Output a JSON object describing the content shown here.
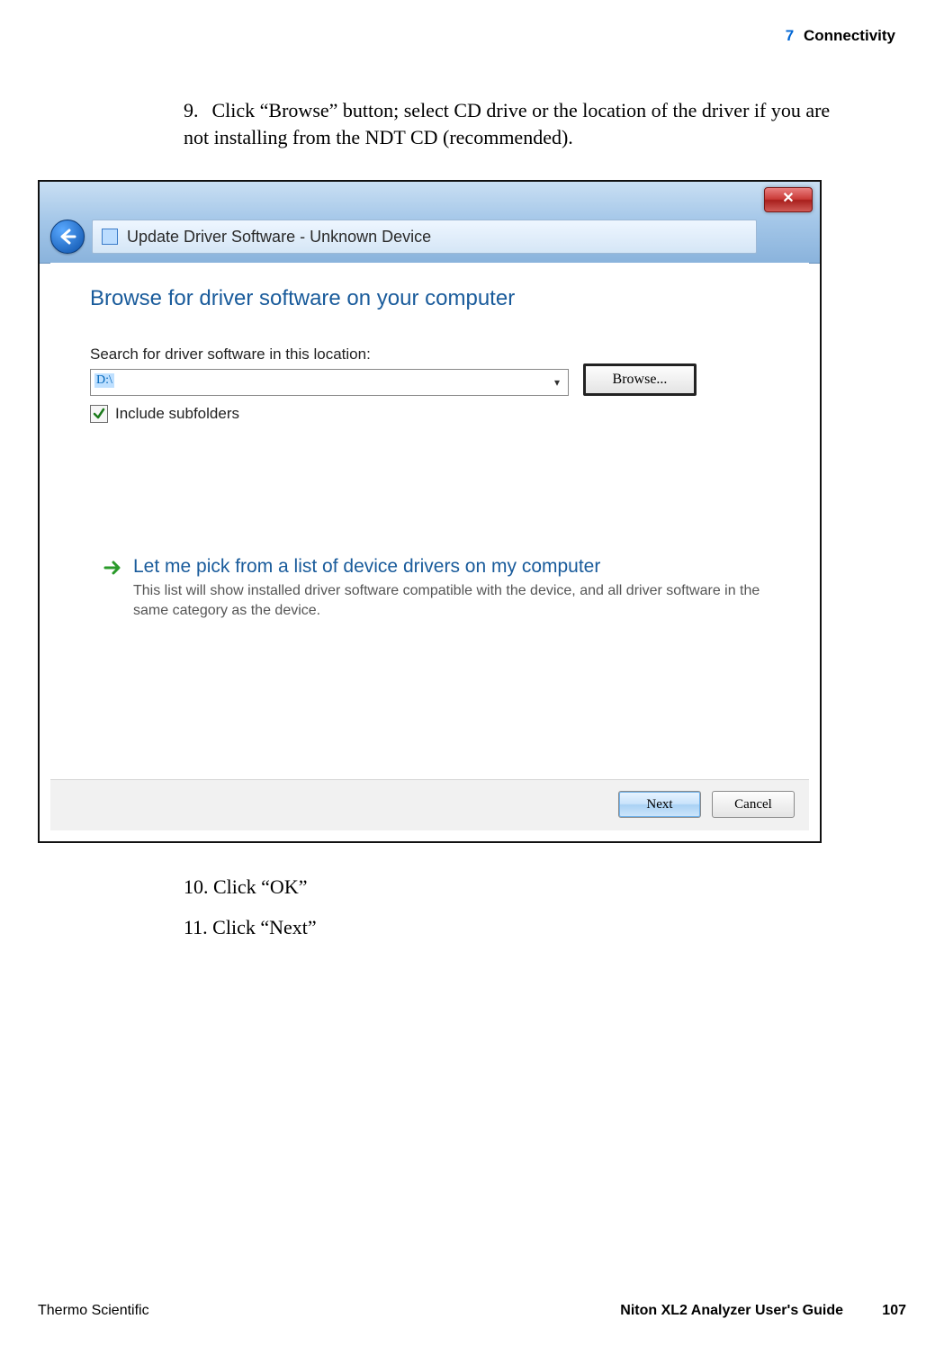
{
  "header": {
    "chapter_num": "7",
    "chapter_title": "Connectivity"
  },
  "steps": {
    "s9_num": "9.",
    "s9_text": "Click “Browse” button; select CD drive or the location of the driver if you are not installing from the NDT CD (recommended).",
    "s10": "10. Click “OK”",
    "s11": "11. Click “Next”"
  },
  "dialog": {
    "close_glyph": "✕",
    "title": "Update Driver Software - Unknown Device",
    "heading": "Browse for driver software on your computer",
    "search_label": "Search for driver software in this location:",
    "path_value": "D:\\",
    "dropdown_glyph": "▾",
    "browse_label": "Browse...",
    "include_subfolders": "Include subfolders",
    "link_title": "Let me pick from a list of device drivers on my computer",
    "link_desc": "This list will show installed driver software compatible with the device, and all driver software in the same category as the device.",
    "next_label": "Next",
    "cancel_label": "Cancel"
  },
  "footer": {
    "brand": "Thermo Scientific",
    "guide": "Niton XL2 Analyzer User's Guide",
    "page": "107"
  }
}
